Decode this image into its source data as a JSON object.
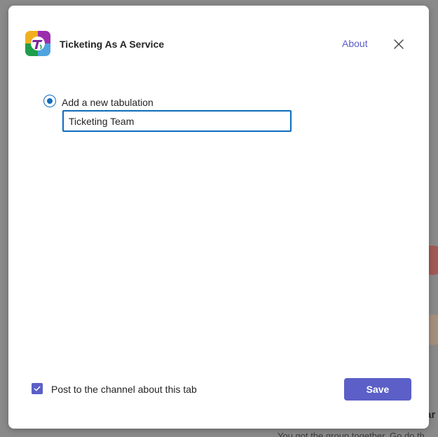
{
  "header": {
    "app_title": "Ticketing As A Service",
    "about_label": "About",
    "app_icon": "ticketing-app-icon",
    "close_icon": "close-icon"
  },
  "form": {
    "option_label": "Add a new tabulation",
    "option_selected": true,
    "tab_name_value": "Ticketing Team"
  },
  "footer": {
    "post_checkbox_label": "Post to the channel about this tab",
    "post_checked": true,
    "save_label": "Save"
  },
  "background": {
    "heading_fragment": "oar",
    "text_fragment": "You got the group together. Go do th"
  },
  "colors": {
    "accent": "#5b5fc7",
    "focus_blue": "#0f6cbd"
  }
}
